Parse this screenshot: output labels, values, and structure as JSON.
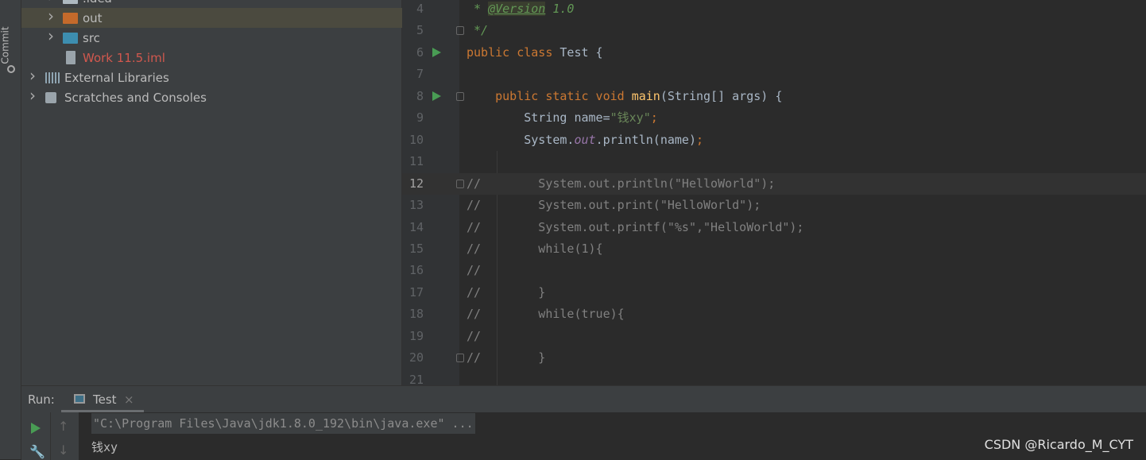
{
  "sidebar": {
    "commit_label": "Commit"
  },
  "project_tree": [
    {
      "label": ".idea",
      "type": "folder",
      "color": "#aeb9c0"
    },
    {
      "label": "out",
      "type": "folder",
      "color": "#c46a2b",
      "selected": true
    },
    {
      "label": "src",
      "type": "folder",
      "color": "#3d8eb0"
    },
    {
      "label": "Work 11.5.iml",
      "type": "file",
      "color": "#d1584e"
    },
    {
      "label": "External Libraries",
      "type": "library"
    },
    {
      "label": "Scratches and Consoles",
      "type": "scratches"
    }
  ],
  "editor": {
    "current_line": "12",
    "lines": [
      {
        "n": "4",
        "t": [
          [
            " * ",
            "doc"
          ],
          [
            "@Version",
            "tag"
          ],
          [
            " 1.0",
            "doc"
          ]
        ]
      },
      {
        "n": "5",
        "fold": true,
        "t": [
          [
            " */",
            "doc"
          ]
        ]
      },
      {
        "n": "6",
        "run": true,
        "t": [
          [
            "public class ",
            "kw"
          ],
          [
            "Test {",
            "pl"
          ]
        ]
      },
      {
        "n": "7",
        "t": []
      },
      {
        "n": "8",
        "run": true,
        "fold": true,
        "t": [
          [
            "    public static void ",
            "kw"
          ],
          [
            "main",
            "fn"
          ],
          [
            "(String[] args) {",
            "pl"
          ]
        ]
      },
      {
        "n": "9",
        "t": [
          [
            "        String name=",
            "pl"
          ],
          [
            "\"钱xy\"",
            "str"
          ],
          [
            ";",
            "kw"
          ]
        ]
      },
      {
        "n": "10",
        "t": [
          [
            "        System.",
            "pl"
          ],
          [
            "out",
            "fld"
          ],
          [
            ".println(name)",
            "pl"
          ],
          [
            ";",
            "kw"
          ]
        ]
      },
      {
        "n": "11",
        "t": []
      },
      {
        "n": "12",
        "fold": true,
        "t": [
          [
            "//        System.out.println(\"HelloWorld\");",
            "cm"
          ]
        ]
      },
      {
        "n": "13",
        "t": [
          [
            "//        System.out.print(\"HelloWorld\");",
            "cm"
          ]
        ]
      },
      {
        "n": "14",
        "t": [
          [
            "//        System.out.printf(\"%s\",\"HelloWorld\");",
            "cm"
          ]
        ]
      },
      {
        "n": "15",
        "t": [
          [
            "//        while(1){",
            "cm"
          ]
        ]
      },
      {
        "n": "16",
        "t": [
          [
            "//",
            "cm"
          ]
        ]
      },
      {
        "n": "17",
        "t": [
          [
            "//        }",
            "cm"
          ]
        ]
      },
      {
        "n": "18",
        "t": [
          [
            "//        while(true){",
            "cm"
          ]
        ]
      },
      {
        "n": "19",
        "t": [
          [
            "//",
            "cm"
          ]
        ]
      },
      {
        "n": "20",
        "fold": true,
        "t": [
          [
            "//        }",
            "cm"
          ]
        ]
      },
      {
        "n": "21",
        "t": []
      }
    ]
  },
  "run_panel": {
    "label": "Run:",
    "tab": "Test",
    "close": "×",
    "command": "\"C:\\Program Files\\Java\\jdk1.8.0_192\\bin\\java.exe\" ...",
    "output": "钱xy"
  },
  "watermark": "CSDN @Ricardo_M_CYT"
}
